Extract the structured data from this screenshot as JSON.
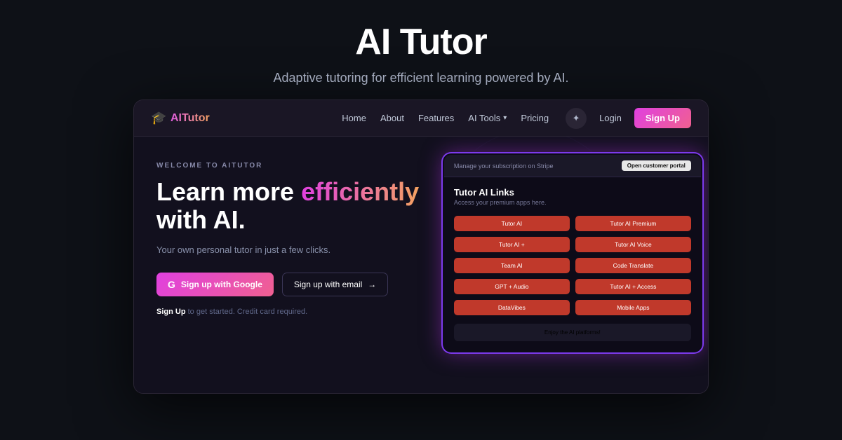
{
  "page": {
    "main_title": "AI Tutor",
    "main_subtitle": "Adaptive tutoring for efficient learning powered by AI."
  },
  "navbar": {
    "logo_text": "AITutor",
    "logo_icon_unicode": "🎓",
    "nav_links": [
      {
        "label": "Home",
        "id": "home"
      },
      {
        "label": "About",
        "id": "about"
      },
      {
        "label": "Features",
        "id": "features"
      },
      {
        "label": "AI Tools",
        "id": "aitools",
        "has_dropdown": true
      },
      {
        "label": "Pricing",
        "id": "pricing"
      }
    ],
    "star_icon": "✦",
    "login_label": "Login",
    "signup_label": "Sign Up"
  },
  "hero": {
    "welcome_label": "WELCOME TO AITUTOR",
    "heading_part1": "Learn more ",
    "heading_highlight": "efficiently",
    "heading_part2": " with AI.",
    "subtext": "Your own personal tutor in just a few clicks.",
    "google_btn_label": "Sign up with Google",
    "email_btn_label": "Sign up with email",
    "signup_note_bold": "Sign Up",
    "signup_note_rest": " to get started. Credit card required."
  },
  "app_panel": {
    "top_text": "Manage your subscription on Stripe",
    "portal_btn_label": "Open customer portal",
    "title": "Tutor AI Links",
    "subtitle": "Access your premium apps here.",
    "links": [
      {
        "label": "Tutor AI",
        "col": 1
      },
      {
        "label": "Tutor AI Premium",
        "col": 2
      },
      {
        "label": "Tutor AI +",
        "col": 1
      },
      {
        "label": "Tutor AI Voice",
        "col": 2
      },
      {
        "label": "Team AI",
        "col": 1
      },
      {
        "label": "Code Translate",
        "col": 2
      },
      {
        "label": "GPT + Audio",
        "col": 1
      },
      {
        "label": "Tutor AI + Access",
        "col": 2
      },
      {
        "label": "DataVibes",
        "col": 1
      },
      {
        "label": "Mobile Apps",
        "col": 2
      }
    ],
    "footer_text": "Enjoy the AI platforms!"
  }
}
